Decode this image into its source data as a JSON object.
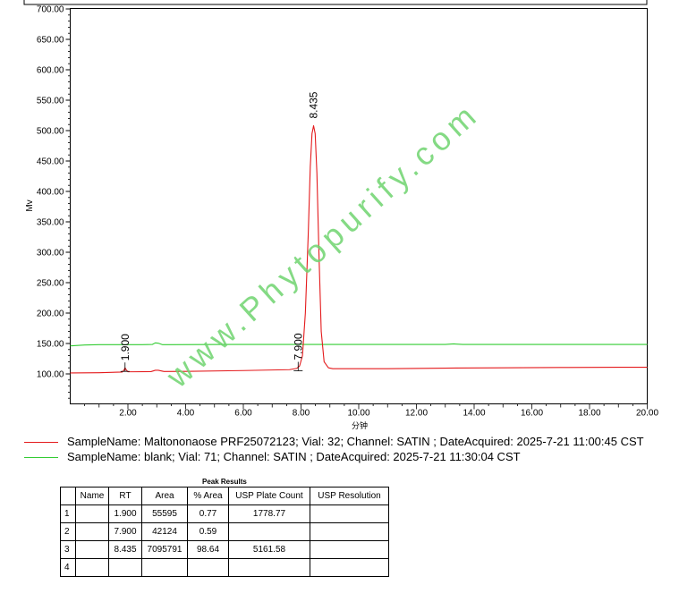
{
  "chart_data": {
    "type": "line",
    "xlabel": "分钟",
    "ylabel": "Mv",
    "xlim": [
      0,
      20
    ],
    "ylim": [
      50,
      700
    ],
    "xticks": [
      "2.00",
      "4.00",
      "6.00",
      "8.00",
      "10.00",
      "12.00",
      "14.00",
      "16.00",
      "18.00",
      "20.00"
    ],
    "yticks": [
      "100.00",
      "150.00",
      "200.00",
      "250.00",
      "300.00",
      "350.00",
      "400.00",
      "450.00",
      "500.00",
      "550.00",
      "600.00",
      "650.00",
      "700.00"
    ],
    "grid": false,
    "legend_position": "bottom",
    "series": [
      {
        "name": "SampleName: Maltononaose PRF25072123; Vial: 32; Channel: SATIN ; DateAcquired: 2025-7-21 11:00:45 CST",
        "color": "#e41a1c",
        "x": [
          0,
          1.0,
          1.8,
          1.86,
          1.9,
          1.95,
          2.0,
          2.2,
          2.8,
          2.95,
          3.05,
          3.25,
          4.0,
          6.0,
          7.6,
          7.85,
          7.9,
          7.95,
          8.05,
          8.15,
          8.25,
          8.32,
          8.38,
          8.435,
          8.49,
          8.55,
          8.62,
          8.7,
          8.8,
          8.95,
          9.1,
          11.0,
          13.0,
          15.0,
          17.0,
          19.0,
          20.0
        ],
        "y": [
          101.5,
          102.0,
          103.0,
          106.0,
          110.0,
          106.0,
          103.5,
          103.5,
          103.8,
          106.0,
          106.0,
          104.0,
          104.2,
          105.5,
          107.0,
          109.0,
          111.0,
          113.0,
          130.0,
          200.0,
          330.0,
          440.0,
          495.0,
          508.0,
          495.0,
          430.0,
          300.0,
          170.0,
          120.0,
          110.0,
          108.5,
          108.5,
          109.5,
          110.0,
          110.5,
          111.0,
          111.0
        ]
      },
      {
        "name": "SampleName: blank; Vial: 71; Channel: SATIN ; DateAcquired: 2025-7-21 11:30:04 CST",
        "color": "#33cc33",
        "x": [
          0,
          0.5,
          1.0,
          2.5,
          2.85,
          2.95,
          3.05,
          3.2,
          3.5,
          6.0,
          10.0,
          13.0,
          13.3,
          13.6,
          16.0,
          20.0
        ],
        "y": [
          146.0,
          147.5,
          148.0,
          148.0,
          148.5,
          151.0,
          150.5,
          148.0,
          148.0,
          148.5,
          148.5,
          148.5,
          149.3,
          148.5,
          148.5,
          148.5
        ]
      }
    ],
    "annotations": [
      {
        "text": "1.900",
        "x": 1.9,
        "y": 110.0
      },
      {
        "text": "7.900",
        "x": 7.9,
        "y": 111.0
      },
      {
        "text": "8.435",
        "x": 8.435,
        "y": 508.0
      }
    ],
    "watermark": "www.Phytopurify.com"
  },
  "peak_results": {
    "title": "Peak Results",
    "headers": [
      "",
      "Name",
      "RT",
      "Area",
      "% Area",
      "USP Plate Count",
      "USP Resolution"
    ],
    "rows": [
      {
        "n": "1",
        "name": "",
        "rt": "1.900",
        "area": "55595",
        "pct": "0.77",
        "plates": "1778.77",
        "res": ""
      },
      {
        "n": "2",
        "name": "",
        "rt": "7.900",
        "area": "42124",
        "pct": "0.59",
        "plates": "",
        "res": ""
      },
      {
        "n": "3",
        "name": "",
        "rt": "8.435",
        "area": "7095791",
        "pct": "98.64",
        "plates": "5161.58",
        "res": ""
      },
      {
        "n": "4",
        "name": "",
        "rt": "",
        "area": "",
        "pct": "",
        "plates": "",
        "res": ""
      }
    ]
  }
}
